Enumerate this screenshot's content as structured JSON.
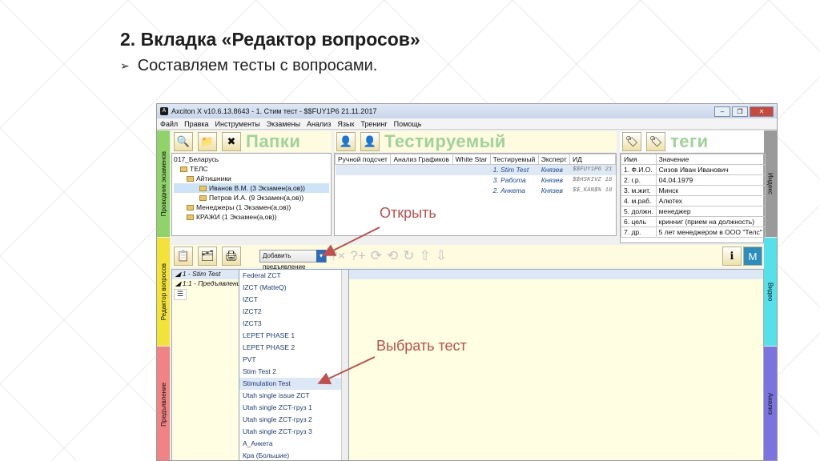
{
  "slide": {
    "title": "2. Вкладка «Редактор вопросов»",
    "bullet": "Составляем тесты с вопросами."
  },
  "window": {
    "title": "Axciton X v10.6.13.8643 - 1. Стим тест - $$FUY1P6 21.11.2017",
    "menu": [
      "Файл",
      "Правка",
      "Инструменты",
      "Экзамены",
      "Анализ",
      "Язык",
      "Тренинг",
      "Помощь"
    ]
  },
  "left_tabs": {
    "exam": "Проводник экзаменов",
    "editor": "Редактор вопросов",
    "present": "Предъявление"
  },
  "right_tabs": {
    "index": "Индекс",
    "video": "Видео",
    "analysis": "Анализ"
  },
  "folders": {
    "header": "Папки",
    "items": [
      "017_Беларусь",
      "ТЕЛС",
      "Айтишники",
      "Иванов В.М. (3 Экзамен(а,ов))",
      "Петров И.А. (9 Экзамен(а,ов))",
      "Менеджеры (1 Экзамен(а,ов))",
      "КРАЖИ (1 Экзамен(а,ов))"
    ]
  },
  "subject": {
    "header": "Тестируемый",
    "columns": [
      "Ручной подсчет",
      "Анализ Графиков",
      "White Star",
      "Тестируемый",
      "Эксперт",
      "ИД"
    ],
    "rows": [
      {
        "name": "1. Stim Test",
        "expert": "Князев",
        "id": "$$FUY1P6",
        "n": "21"
      },
      {
        "name": "3. Работа",
        "expert": "Князев",
        "id": "$$HSKIVZ",
        "n": "18"
      },
      {
        "name": "2. Анкета",
        "expert": "Князев",
        "id": "$$_KAN$%",
        "n": "18"
      }
    ]
  },
  "tags": {
    "header": "теги",
    "columns": [
      "Имя",
      "Значение"
    ],
    "rows": [
      [
        "1. Ф.И.О.",
        "Сизов Иван Иванович"
      ],
      [
        "2. г.р.",
        "04.04.1979"
      ],
      [
        "3. м.жит.",
        "Минск"
      ],
      [
        "4. м.раб.",
        "Алютех"
      ],
      [
        "5. должн.",
        "менеджер"
      ],
      [
        "6. цель",
        "кринниг (прием на должность)"
      ],
      [
        "7. др.",
        "5 лет менеджером в ООО \"Телс\""
      ]
    ]
  },
  "editor": {
    "combo": "Добавить предъявление",
    "tree": [
      "1 - Stim Test",
      "1:1 - Предъявлени"
    ],
    "tree_btn": "☰"
  },
  "dropdown": {
    "items": [
      "Federal ZCT",
      "IZCT (MatteQ)",
      "IZCT",
      "IZCT2",
      "IZCT3",
      "LEPET PHASE 1",
      "LEPET PHASE 2",
      "PVT",
      "Stim Test 2",
      "Stimulation Test",
      "Utah single issue ZCT",
      "Utah single ZCT-груз 1",
      "Utah single ZCT-груз 2",
      "Utah single ZCT-груз 3",
      "A_Анкета",
      "Кра (Большие)"
    ],
    "selected": "Stimulation Test"
  },
  "annotations": {
    "open": "Открыть",
    "choose": "Выбрать тест"
  },
  "colors": {
    "annotation": "#c0504d",
    "green_tab": "#8fd36a",
    "yellow_tab": "#f3e23a",
    "red_tab": "#f08484",
    "cyan_tab": "#55e0ea",
    "blue_tab": "#7b74e0"
  }
}
